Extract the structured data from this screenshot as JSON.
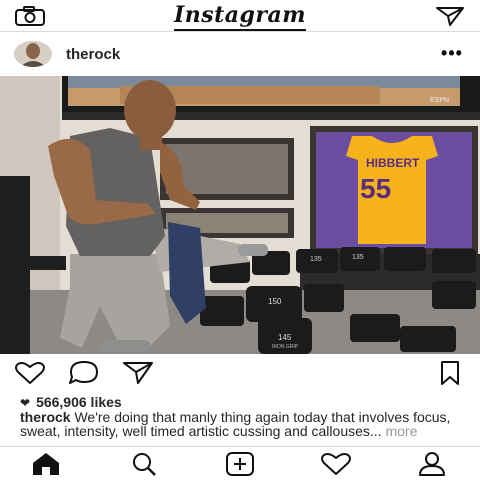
{
  "app": {
    "logo_text": "Instagram"
  },
  "topbar": {
    "camera_icon": "camera-icon",
    "direct_icon": "paper-plane-icon"
  },
  "post": {
    "username": "therock",
    "more_icon": "more-dots-icon",
    "more_label": "•••",
    "photo_texts": {
      "tv_logo": "ESPN",
      "jersey_name": "HIBBERT",
      "jersey_number": "55",
      "dumbbell_weights": [
        "145",
        "150",
        "135",
        "135"
      ],
      "dumbbell_brand": "IRON GRIP"
    },
    "likes_count_text": "566,906 likes",
    "caption_user": "therock",
    "caption_text": "We're doing that manly thing again today that involves focus, sweat, intensity, well timed artistic cussing and callouses...",
    "caption_more": "more"
  },
  "actions": [
    "heart-icon",
    "comment-icon",
    "share-icon",
    "bookmark-icon"
  ],
  "bottomnav": [
    "home-icon",
    "search-icon",
    "add-post-icon",
    "activity-heart-icon",
    "profile-icon"
  ]
}
